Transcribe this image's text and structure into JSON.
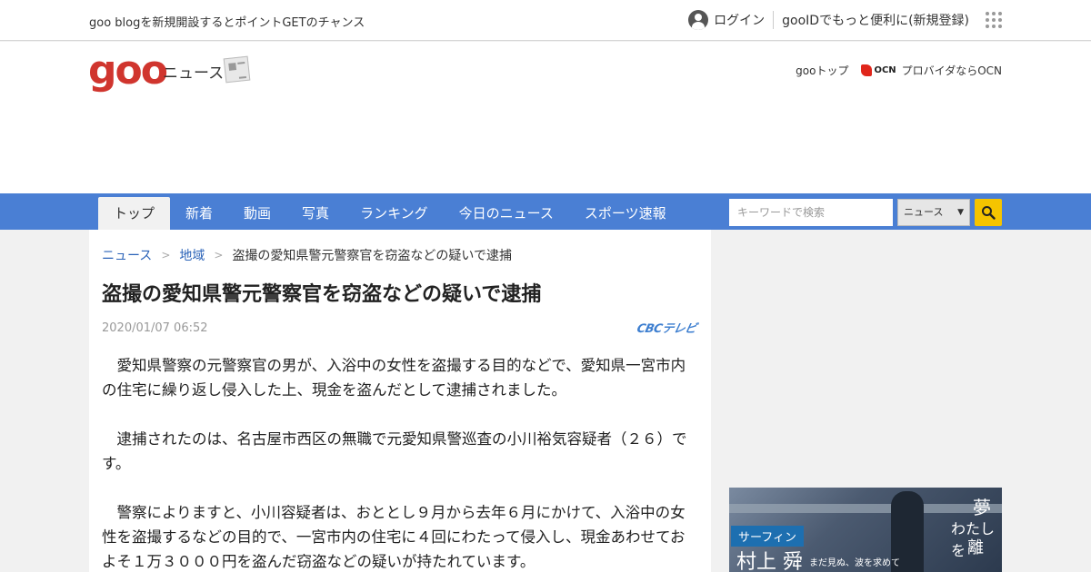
{
  "topbar": {
    "promo": "goo blogを新規開設するとポイントGETのチャンス",
    "login_label": "ログイン",
    "register_label": "gooIDでもっと便利に(新規登録)"
  },
  "header": {
    "logo_text": "goo",
    "logo_sub": "ニュース",
    "goo_top_label": "gooトップ",
    "ocn_logo_text": "OCN",
    "ocn_label": "プロバイダならOCN"
  },
  "nav": {
    "tabs": [
      {
        "label": "トップ",
        "active": true
      },
      {
        "label": "新着"
      },
      {
        "label": "動画"
      },
      {
        "label": "写真"
      },
      {
        "label": "ランキング"
      },
      {
        "label": "今日のニュース"
      },
      {
        "label": "スポーツ速報"
      }
    ],
    "search_placeholder": "キーワードで検索",
    "select_value": "ニュース"
  },
  "article": {
    "breadcrumb": [
      "ニュース",
      "地域",
      "盗撮の愛知県警元警察官を窃盗などの疑いで逮捕"
    ],
    "title": "盗撮の愛知県警元警察官を窃盗などの疑いで逮捕",
    "date": "2020/01/07 06:52",
    "source": "CBCテレビ",
    "paragraphs": [
      "愛知県警察の元警察官の男が、入浴中の女性を盗撮する目的などで、愛知県一宮市内の住宅に繰り返し侵入した上、現金を盗んだとして逮捕されました。",
      "逮捕されたのは、名古屋市西区の無職で元愛知県警巡査の小川裕気容疑者（２６）です。",
      "警察によりますと、小川容疑者は、おととし９月から去年６月にかけて、入浴中の女性を盗撮するなどの目的で、一宮市内の住宅に４回にわたって侵入し、現金あわせておよそ１万３０００円を盗んだ窃盗などの疑いが持たれています。"
    ]
  },
  "side_ad": {
    "tag": "サーフィン",
    "name": "村上 舜",
    "catch": "まだ見ぬ、波を求めて",
    "vertical_1": "夢",
    "vertical_2": "わたしを",
    "vertical_3": "離"
  },
  "colors": {
    "nav_blue": "#4a7fd4",
    "logo_red": "#d0352e",
    "link_blue": "#2b63b8",
    "search_button_yellow": "#f5c400"
  }
}
